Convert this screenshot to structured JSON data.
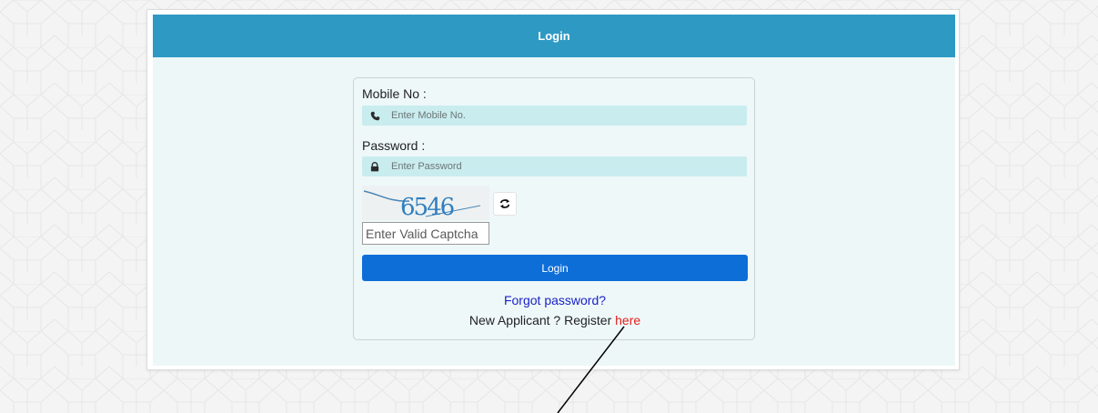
{
  "header": {
    "title": "Login"
  },
  "form": {
    "mobile_label": "Mobile No :",
    "mobile_placeholder": "Enter Mobile No.",
    "password_label": "Password :",
    "password_placeholder": "Enter Password",
    "captcha_text": "6546",
    "captcha_placeholder": "Enter Valid Captcha",
    "login_button": "Login",
    "forgot_password": "Forgot password?",
    "register_prefix": "New Applicant ? Register ",
    "register_link": "here"
  },
  "icons": {
    "mobile": "phone-icon",
    "password": "lock-icon",
    "refresh": "refresh-icon"
  },
  "colors": {
    "header": "#2e9ac4",
    "login_button": "#0d6ed8",
    "forgot_link": "#1a22c9",
    "register_link": "#e02020",
    "input_bg": "#c9ecef"
  }
}
